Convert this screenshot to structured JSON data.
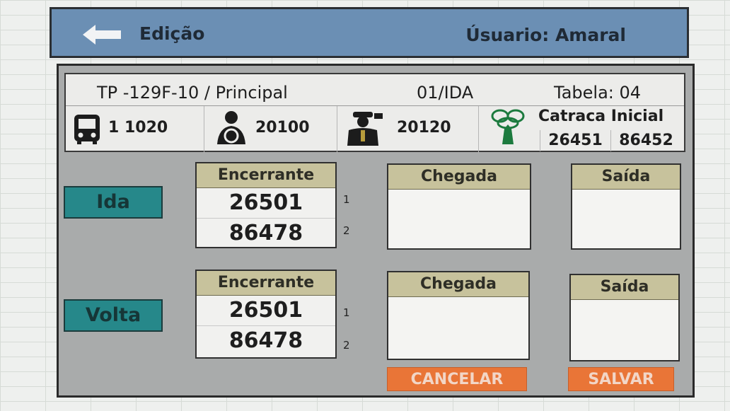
{
  "header": {
    "back_icon": "arrow-left-icon",
    "title": "Edição",
    "user": "Úsuario: Amaral"
  },
  "info": {
    "route": "TP -129F-10 / Principal",
    "direction": "01/IDA",
    "tabela": "Tabela: 04",
    "bus": {
      "icon": "bus-icon",
      "value": "1 1020"
    },
    "driver": {
      "icon": "driver-icon",
      "value": "20100"
    },
    "conductor": {
      "icon": "conductor-icon",
      "value": "20120"
    },
    "catraca": {
      "icon": "turnstile-icon",
      "label": "Catraca Inicial",
      "values": [
        "26451",
        "86452"
      ]
    }
  },
  "ida": {
    "label": "Ida",
    "encerrante": {
      "title": "Encerrante",
      "values": [
        "26501",
        "86478"
      ],
      "indices": [
        "1",
        "2"
      ]
    },
    "chegada": {
      "title": "Chegada",
      "value": ""
    },
    "saida": {
      "title": "Saída",
      "value": ""
    }
  },
  "volta": {
    "label": "Volta",
    "encerrante": {
      "title": "Encerrante",
      "values": [
        "26501",
        "86478"
      ],
      "indices": [
        "1",
        "2"
      ]
    },
    "chegada": {
      "title": "Chegada",
      "value": ""
    },
    "saida": {
      "title": "Saída",
      "value": ""
    }
  },
  "actions": {
    "cancel": "CANCELAR",
    "save": "SALVAR"
  },
  "colors": {
    "header_bg": "#6b8fb4",
    "panel_bg": "#a9abab",
    "direction_button": "#26888a",
    "panel_header": "#c7c29c",
    "action_button": "#e97537"
  }
}
